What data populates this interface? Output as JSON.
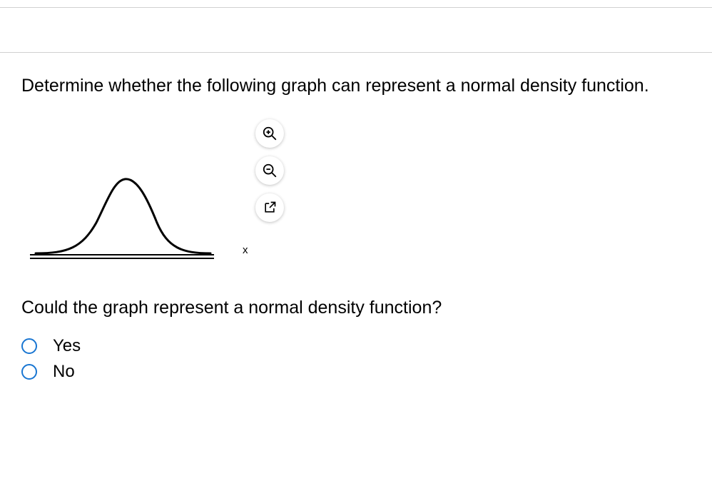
{
  "question": "Determine whether the following graph can represent a normal density function.",
  "followUp": "Could the graph represent a normal density function?",
  "axisLabel": "x",
  "icons": {
    "zoomIn": "zoom-in-icon",
    "zoomOut": "zoom-out-icon",
    "popOut": "pop-out-icon"
  },
  "options": [
    {
      "label": "Yes"
    },
    {
      "label": "No"
    }
  ]
}
